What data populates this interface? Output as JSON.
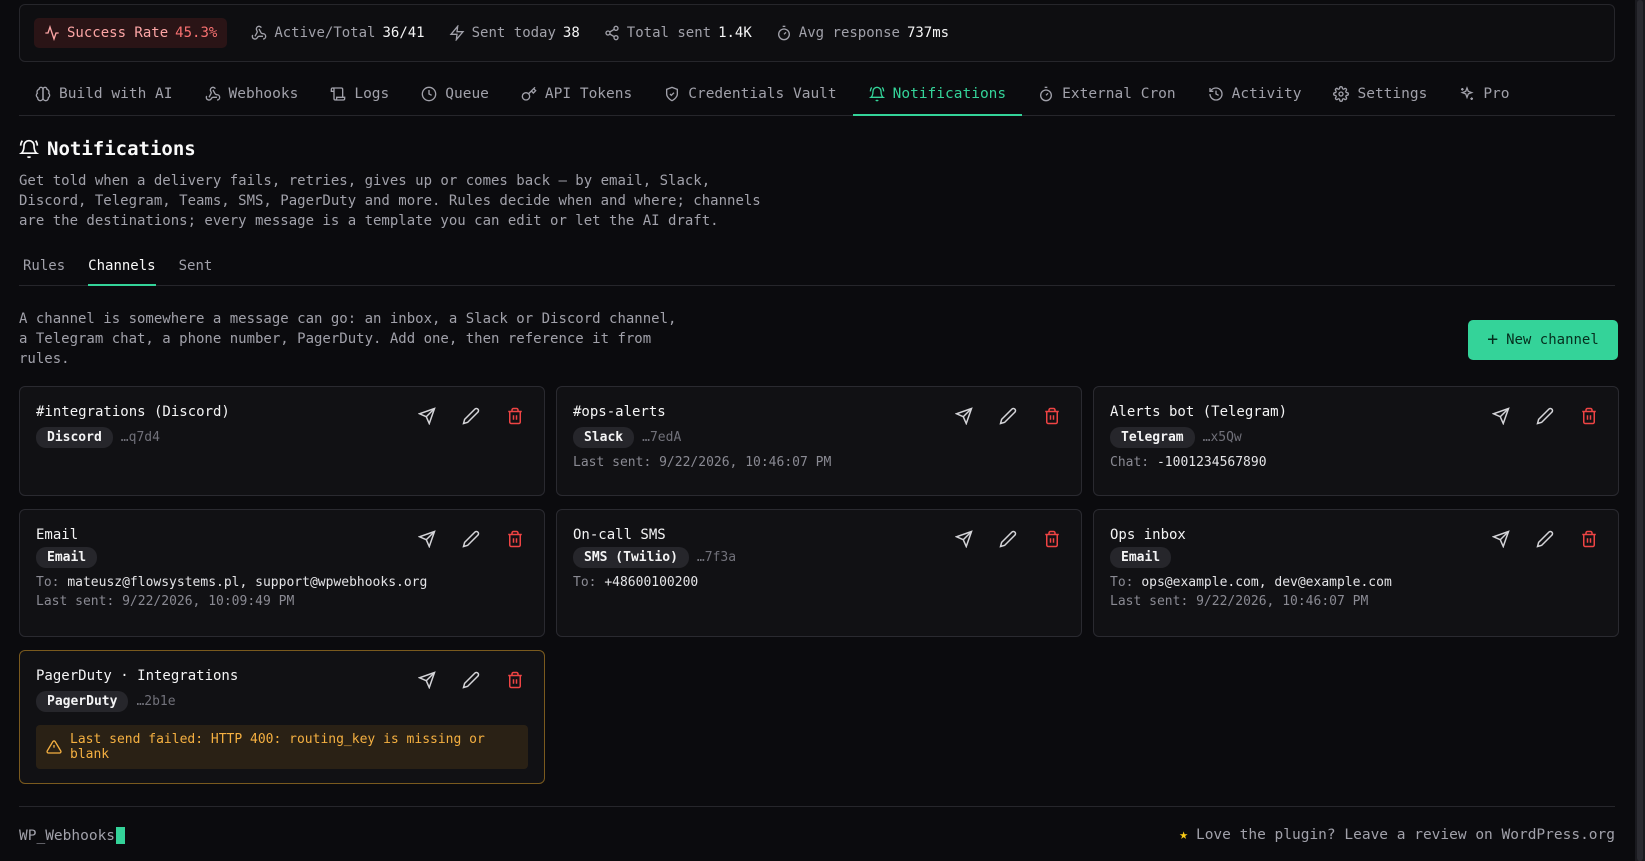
{
  "stats": {
    "success_label": "Success Rate",
    "success_value": "45.3%",
    "active_label": "Active/Total",
    "active_value": "36/41",
    "sent_today_label": "Sent today",
    "sent_today_value": "38",
    "total_sent_label": "Total sent",
    "total_sent_value": "1.4K",
    "avg_label": "Avg response",
    "avg_value": "737ms"
  },
  "nav": [
    {
      "label": "Build with AI",
      "icon": "brain-icon"
    },
    {
      "label": "Webhooks",
      "icon": "webhook-icon"
    },
    {
      "label": "Logs",
      "icon": "scroll-icon"
    },
    {
      "label": "Queue",
      "icon": "clock-icon"
    },
    {
      "label": "API Tokens",
      "icon": "key-icon"
    },
    {
      "label": "Credentials Vault",
      "icon": "shield-icon"
    },
    {
      "label": "Notifications",
      "icon": "bell-icon"
    },
    {
      "label": "External Cron",
      "icon": "timer-icon"
    },
    {
      "label": "Activity",
      "icon": "history-icon"
    },
    {
      "label": "Settings",
      "icon": "gear-icon"
    },
    {
      "label": "Pro",
      "icon": "sparkles-icon"
    }
  ],
  "page": {
    "title": "Notifications",
    "desc_1": "Get told when a delivery fails, retries, gives up or comes back — by email, Slack,",
    "desc_2": "Discord, Telegram, Teams, SMS, PagerDuty and more. Rules decide when and where; channels",
    "desc_3": "are the destinations; every message is a template you can edit or let the AI draft."
  },
  "subtabs": [
    "Rules",
    "Channels",
    "Sent"
  ],
  "intro": {
    "line_1": "A channel is somewhere a message can go: an inbox, a Slack or Discord channel,",
    "line_2": "a Telegram chat, a phone number, PagerDuty. Add one, then reference it from",
    "line_3": "rules."
  },
  "new_channel_label": "New channel",
  "channels": [
    {
      "name": "#integrations (Discord)",
      "badge": "Discord",
      "suffix": "…q7d4"
    },
    {
      "name": "#ops-alerts",
      "badge": "Slack",
      "suffix": "…7edA",
      "meta_label": "Last sent:",
      "meta_value": "9/22/2026, 10:46:07 PM"
    },
    {
      "name": "Alerts bot (Telegram)",
      "badge": "Telegram",
      "suffix": "…x5Qw",
      "meta_label": "Chat:",
      "meta_value": "-1001234567890"
    },
    {
      "name": "Email",
      "badge": "Email",
      "suffix": "",
      "to_label": "To:",
      "to_value": "mateusz@flowsystems.pl, support@wpwebhooks.org",
      "meta_label": "Last sent:",
      "meta_value": "9/22/2026, 10:09:49 PM"
    },
    {
      "name": "On-call SMS",
      "badge": "SMS (Twilio)",
      "suffix": "…7f3a",
      "to_label": "To:",
      "to_value": "+48600100200"
    },
    {
      "name": "Ops inbox",
      "badge": "Email",
      "suffix": "",
      "to_label": "To:",
      "to_value": "ops@example.com, dev@example.com",
      "meta_label": "Last sent:",
      "meta_value": "9/22/2026, 10:46:07 PM"
    },
    {
      "name": "PagerDuty · Integrations",
      "badge": "PagerDuty",
      "suffix": "…2b1e",
      "error": "Last send failed: HTTP 400: routing_key is missing or blank"
    }
  ],
  "footer": {
    "brand": "WP_Webhooks",
    "review": "Love the plugin? Leave a review on WordPress.org"
  },
  "colors": {
    "accent": "#34d399",
    "danger": "#ef4444",
    "warning": "#f5b041",
    "background": "#0b0b0e"
  }
}
